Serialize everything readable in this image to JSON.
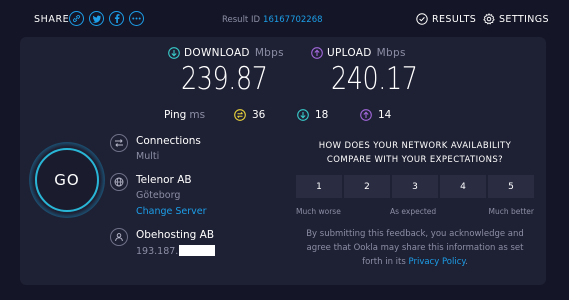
{
  "header": {
    "share_label": "SHARE",
    "share_icons": [
      "link-icon",
      "twitter-icon",
      "facebook-icon",
      "more-icon"
    ],
    "result_id_label": "Result ID",
    "result_id": "16167702268",
    "results_label": "RESULTS",
    "settings_label": "SETTINGS"
  },
  "speed": {
    "download": {
      "label": "DOWNLOAD",
      "unit": "Mbps",
      "value": "239.87",
      "icon": "download-arrow-icon",
      "color": "#38c8c8"
    },
    "upload": {
      "label": "UPLOAD",
      "unit": "Mbps",
      "value": "240.17",
      "icon": "upload-arrow-icon",
      "color": "#a067d9"
    }
  },
  "ping": {
    "label": "Ping",
    "unit": "ms",
    "idle": "36",
    "download": "18",
    "upload": "14"
  },
  "go_label": "GO",
  "connections": {
    "title": "Connections",
    "value": "Multi"
  },
  "server": {
    "name": "Telenor AB",
    "location": "Göteborg",
    "change_label": "Change Server"
  },
  "isp": {
    "name": "Obehosting AB",
    "ip_visible": "193.187."
  },
  "survey": {
    "question": "HOW DOES YOUR NETWORK AVAILABILITY COMPARE WITH YOUR EXPECTATIONS?",
    "options": [
      "1",
      "2",
      "3",
      "4",
      "5"
    ],
    "label_low": "Much worse",
    "label_mid": "As expected",
    "label_high": "Much better",
    "consent_text": "By submitting this feedback, you acknowledge and agree that Ookla may share this information as set forth in its",
    "privacy_link": "Privacy Policy",
    "consent_end": "."
  },
  "colors": {
    "accent": "#1c9ee8",
    "background": "#141526",
    "panel": "#1e2033",
    "ping_idle": "#e8d23c"
  }
}
